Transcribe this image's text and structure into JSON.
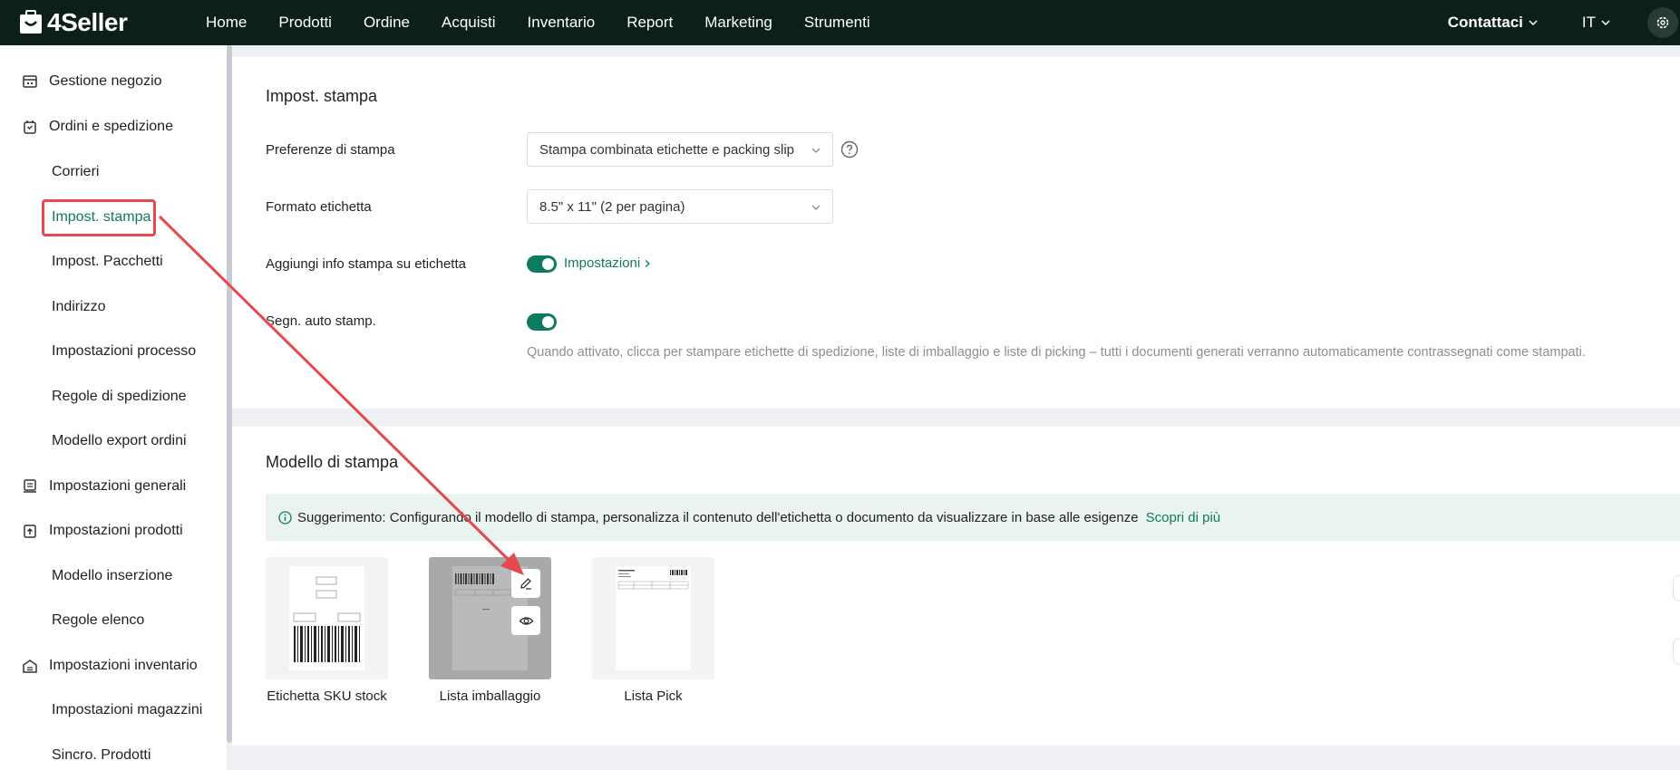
{
  "brand": {
    "name": "4Seller"
  },
  "nav": {
    "items": [
      "Home",
      "Prodotti",
      "Ordine",
      "Acquisti",
      "Inventario",
      "Report",
      "Marketing",
      "Strumenti"
    ]
  },
  "header": {
    "contact": "Contattaci",
    "lang": "IT"
  },
  "sidebar": {
    "group_store": "Gestione negozio",
    "group_orders": "Ordini e spedizione",
    "item_carriers": "Corrieri",
    "item_print": "Impost. stampa",
    "item_packages": "Impost. Pacchetti",
    "item_address": "Indirizzo",
    "item_process": "Impostazioni processo",
    "item_shipping_rules": "Regole di spedizione",
    "item_export": "Modello export ordini",
    "group_general": "Impostazioni generali",
    "group_products": "Impostazioni prodotti",
    "item_listing_tpl": "Modello inserzione",
    "item_list_rules": "Regole elenco",
    "group_inventory": "Impostazioni inventario",
    "item_warehouses": "Impostazioni magazzini",
    "item_sync": "Sincro. Prodotti"
  },
  "print_settings": {
    "title": "Impost. stampa",
    "pref_label": "Preferenze di stampa",
    "pref_value": "Stampa combinata etichette e packing slip",
    "format_label": "Formato etichetta",
    "format_value": "8.5\" x 11\" (2 per pagina)",
    "add_info_label": "Aggiungi info stampa su etichetta",
    "add_info_on": true,
    "settings_link": "Impostazioni",
    "auto_mark_label": "Segn. auto stamp.",
    "auto_mark_on": true,
    "auto_mark_hint": "Quando attivato, clicca per stampare etichette di spedizione, liste di imballaggio e liste di picking – tutti i documenti generati verranno automaticamente contrassegnati come stampati."
  },
  "templates": {
    "title": "Modello di stampa",
    "tip": "Suggerimento: Configurando il modello di stampa, personalizza il contenuto dell'etichetta o documento da visualizzare in base alle esigenze",
    "tip_link": "Scopri di più",
    "items": [
      {
        "label": "Etichetta SKU stock"
      },
      {
        "label": "Lista imballaggio"
      },
      {
        "label": "Lista Pick"
      }
    ]
  },
  "colors": {
    "accent": "#0f7a5f",
    "topbar": "#0d1f1a",
    "highlight": "#e5484d"
  }
}
